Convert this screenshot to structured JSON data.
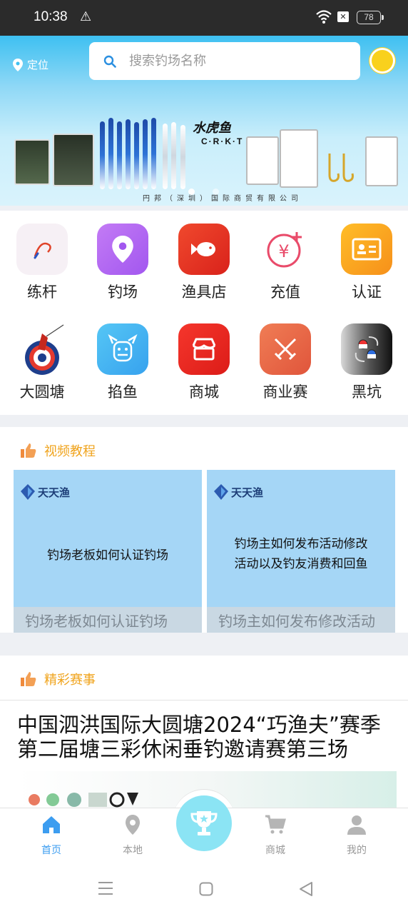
{
  "status_bar": {
    "time": "10:38",
    "battery": "78"
  },
  "header": {
    "location_label": "定位",
    "search_placeholder": "搜索钓场名称"
  },
  "banner": {
    "brand_name": "水虎鱼",
    "brand_sub": "C·R·K·T",
    "company": "円邦（深圳）国际商贸有限公司",
    "page_indicator": {
      "count": 2,
      "active": 1
    }
  },
  "grid": {
    "items": [
      {
        "label": "练杆",
        "icon": "fishing-rod-icon",
        "color": "#f3eef5"
      },
      {
        "label": "钓场",
        "icon": "location-pin-icon",
        "color": "#b46af2"
      },
      {
        "label": "渔具店",
        "icon": "fish-icon",
        "color": "#ee3a28"
      },
      {
        "label": "充值",
        "icon": "yen-plus-icon",
        "color": "#ffffff"
      },
      {
        "label": "认证",
        "icon": "id-card-icon",
        "color": "#f7a21a"
      },
      {
        "label": "大圆塘",
        "icon": "angler-target-icon",
        "color": "#ffffff"
      },
      {
        "label": "掐鱼",
        "icon": "viking-icon",
        "color": "#4bb7f2"
      },
      {
        "label": "商城",
        "icon": "store-icon",
        "color": "#ee2c25"
      },
      {
        "label": "商业赛",
        "icon": "crossed-swords-icon",
        "color": "#e8684a"
      },
      {
        "label": "黑坑",
        "icon": "pokeball-swap-icon",
        "color": "#222222"
      }
    ]
  },
  "videos": {
    "section_title": "视频教程",
    "items": [
      {
        "logo": "天天渔",
        "overlay": [
          "钓场老板如何认证钓场"
        ],
        "caption": "钓场老板如何认证钓场"
      },
      {
        "logo": "天天渔",
        "overlay": [
          "钓场主如何发布活动修改",
          "活动以及钓友消费和回鱼"
        ],
        "caption": "钓场主如何发布修改活动"
      }
    ]
  },
  "events": {
    "section_title": "精彩赛事",
    "headline": "中国泗洪国际大圆塘2024“巧渔夫”赛季第二届塘三彩休闲垂钓邀请赛第三场"
  },
  "tabbar": {
    "items": [
      {
        "label": "首页",
        "icon": "home-icon",
        "active": true
      },
      {
        "label": "本地",
        "icon": "location-pin-icon",
        "active": false
      },
      {
        "label": "商城",
        "icon": "cart-icon",
        "active": false
      },
      {
        "label": "我的",
        "icon": "person-icon",
        "active": false
      }
    ],
    "center_icon": "trophy-icon"
  },
  "colors": {
    "accent": "#3c9df0",
    "section_title": "#f0a41e",
    "video_bg": "#a5d6f6"
  }
}
